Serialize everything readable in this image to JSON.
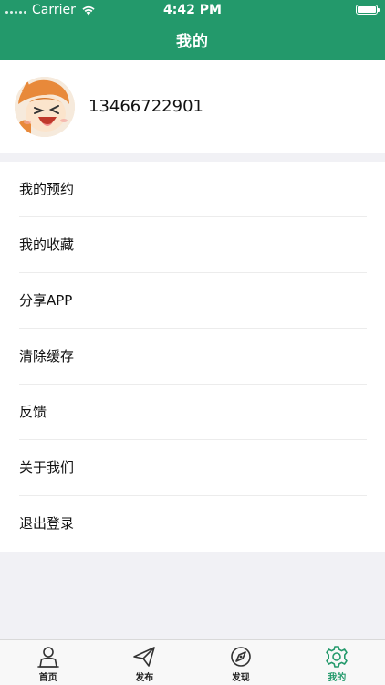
{
  "status_bar": {
    "carrier": "Carrier",
    "time": "4:42 PM"
  },
  "nav": {
    "title": "我的"
  },
  "profile": {
    "phone": "13466722901"
  },
  "menu": {
    "items": [
      {
        "label": "我的预约"
      },
      {
        "label": "我的收藏"
      },
      {
        "label": "分享APP"
      },
      {
        "label": "清除缓存"
      },
      {
        "label": "反馈"
      },
      {
        "label": "关于我们"
      },
      {
        "label": "退出登录"
      }
    ]
  },
  "tabbar": {
    "items": [
      {
        "label": "首页",
        "icon": "home-person-icon"
      },
      {
        "label": "发布",
        "icon": "paper-plane-icon"
      },
      {
        "label": "发现",
        "icon": "compass-icon"
      },
      {
        "label": "我的",
        "icon": "gear-icon",
        "active": true
      }
    ]
  },
  "colors": {
    "accent": "#23996b",
    "page_bg": "#f1f1f5"
  }
}
